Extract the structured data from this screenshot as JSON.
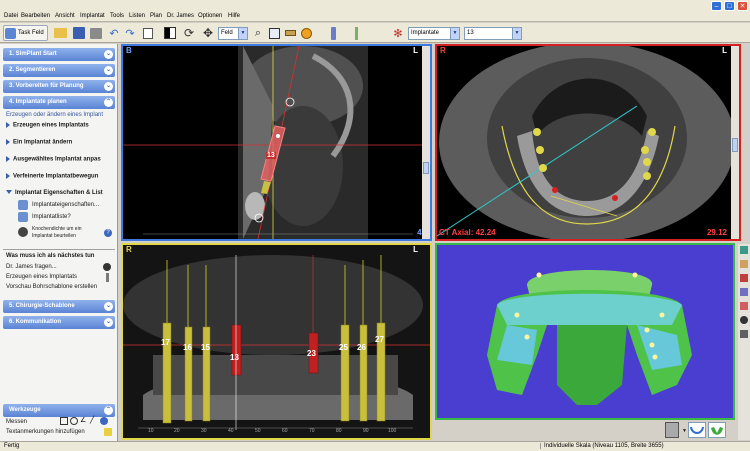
{
  "menu": [
    "Datei",
    "Bearbeiten",
    "Ansicht",
    "Implantat",
    "Tools",
    "Listen",
    "Plan",
    "Dr. James",
    "Optionen",
    "Hilfe"
  ],
  "toolbar": {
    "taskfeld_label": "Task Feld",
    "view_select": "Feld",
    "implant_select": "Implantate",
    "number_select": "13"
  },
  "sidebar": {
    "steps": [
      {
        "label": "1. SimPlant Start"
      },
      {
        "label": "2. Segmentieren"
      },
      {
        "label": "3. Vorbereiten für Planung"
      },
      {
        "label": "4. Implantate planen"
      }
    ],
    "section_title": "Erzeugen oder ändern eines Implant",
    "actions": [
      "Erzeugen eines Implantats",
      "Ein Implantat ändern",
      "Ausgewähltes Implantat anpas",
      "Verfeinerte Implantatbewegun",
      "Implantat Eigenschaften & List"
    ],
    "sub_items": [
      "Implantateigenschaften...",
      "Implantatliste?"
    ],
    "density_line1": "Knochendichte um ein",
    "density_line2": "Implantat beurteilen",
    "next_title": "Was muss ich als nächstes tun",
    "next_items": [
      "Dr. James fragen...",
      "Erzeugen eines Implantats",
      "Vorschau Bohrschablone erstellen"
    ],
    "steps2": [
      {
        "label": "5. Chirurgie-Schablone"
      },
      {
        "label": "6. Kommunikation"
      }
    ],
    "tools_title": "Werkzeuge",
    "tools_items": [
      "Messen",
      "Textanmerkungen hinzufügen"
    ]
  },
  "views": {
    "sagittal": {
      "label_left": "B",
      "label_right": "L",
      "implant_no": "13",
      "slice": "42"
    },
    "axial": {
      "label_left": "R",
      "label_right": "L",
      "title": "CT Axial: 42.24",
      "value": "29.12"
    },
    "panoramic": {
      "label_left": "R",
      "label_right": "L",
      "implants": [
        "17",
        "16",
        "15",
        "13",
        "23",
        "25",
        "26",
        "27"
      ],
      "ruler": [
        "10",
        "20",
        "30",
        "40",
        "50",
        "60",
        "70",
        "80",
        "90",
        "100"
      ]
    },
    "render3d": {}
  },
  "status": {
    "left": "Fertig",
    "scale": "Individuelle Skala (Niveau 1105, Breite 3655)"
  },
  "colors": {
    "sagittal_border": "#3d7be0",
    "axial_border": "#d42020",
    "panoramic_border": "#e0d84a",
    "render_border": "#38b848",
    "render_bg": "#4a3ed0"
  },
  "icons": [
    "taskfield-icon",
    "folder-icon",
    "save-icon",
    "print-icon",
    "undo-icon",
    "redo-icon",
    "copy-icon",
    "contrast-icon",
    "rotate-icon",
    "pan-icon",
    "zoom-icon",
    "zoom-fit-icon",
    "ruler-icon",
    "implant-icon",
    "tooth-icon"
  ]
}
